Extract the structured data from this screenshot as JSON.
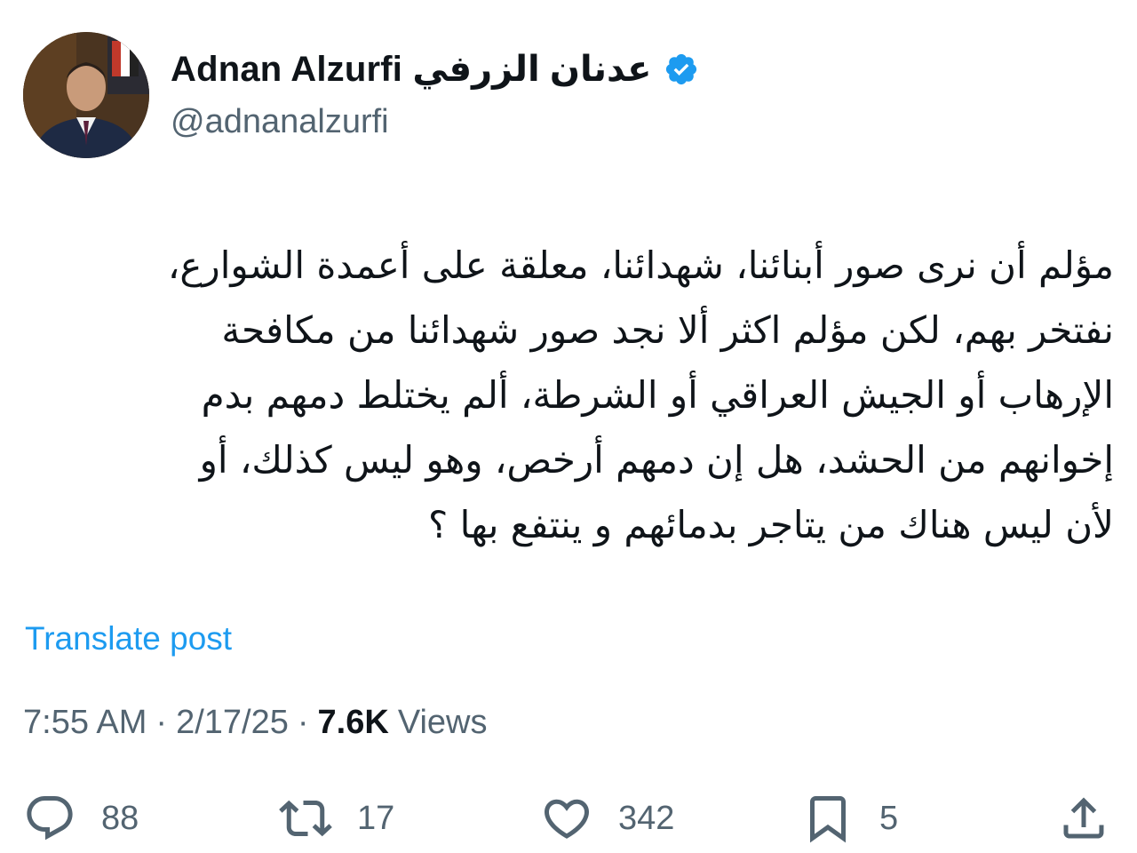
{
  "author": {
    "display_name": "Adnan Alzurfi عدنان الزرفي",
    "handle": "@adnanalzurfi",
    "verified_icon": "verified-badge-icon",
    "verified_color": "#1d9bf0"
  },
  "tweet": {
    "text": "مؤلم أن نرى صور أبنائنا، شهدائنا، معلقة على أعمدة الشوارع،\nنفتخر بهم، لكن مؤلم اكثر ألا نجد صور شهدائنا من مكافحة\nالإرهاب أو الجيش العراقي أو الشرطة، ألم يختلط دمهم بدم\nإخوانهم من الحشد، هل إن دمهم أرخص، وهو ليس كذلك، أو\nلأن ليس هناك من يتاجر بدمائهم و ينتفع بها ؟",
    "translate_label": "Translate post"
  },
  "meta": {
    "time": "7:55 AM",
    "separator": "·",
    "date": "2/17/25",
    "views_count": "7.6K",
    "views_label": "Views"
  },
  "actions": {
    "reply": {
      "icon": "reply-icon",
      "count": "88"
    },
    "repost": {
      "icon": "repost-icon",
      "count": "17"
    },
    "like": {
      "icon": "heart-icon",
      "count": "342"
    },
    "bookmark": {
      "icon": "bookmark-icon",
      "count": "5"
    },
    "share": {
      "icon": "share-icon"
    }
  },
  "colors": {
    "text_primary": "#0f1419",
    "text_secondary": "#536471",
    "accent": "#1d9bf0"
  }
}
